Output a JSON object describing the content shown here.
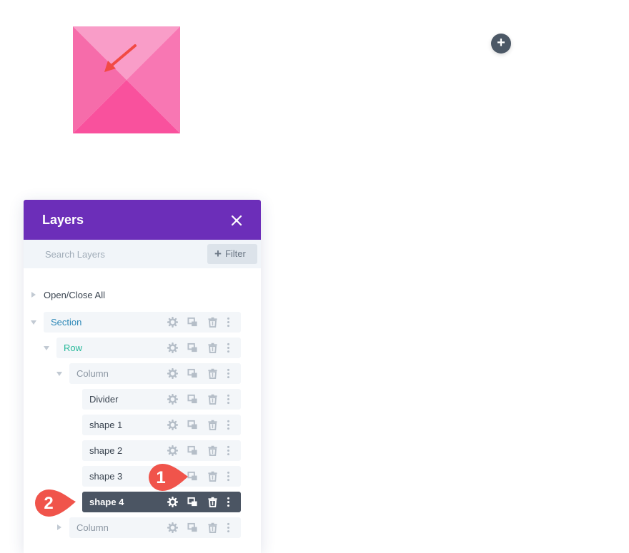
{
  "colors": {
    "header_bg": "#6c2eb9",
    "section_text": "#2d88b7",
    "row_text": "#27b99a",
    "column_text": "#8c97a3",
    "module_text": "#3a4450",
    "selected_bg": "#4b5563",
    "badge": "#f0544b",
    "shape_pink": "#f86aa9"
  },
  "add_button": {
    "icon": "plus-icon"
  },
  "layers_panel": {
    "title": "Layers",
    "close_icon": "close-icon",
    "search": {
      "placeholder": "Search Layers",
      "value": ""
    },
    "filter_label": "Filter",
    "toggle_all_label": "Open/Close All",
    "items": [
      {
        "label": "Section",
        "level": 0,
        "type": "section",
        "expanded": true
      },
      {
        "label": "Row",
        "level": 1,
        "type": "row",
        "expanded": true
      },
      {
        "label": "Column",
        "level": 2,
        "type": "column",
        "expanded": true
      },
      {
        "label": "Divider",
        "level": 3,
        "type": "module"
      },
      {
        "label": "shape 1",
        "level": 3,
        "type": "module"
      },
      {
        "label": "shape 2",
        "level": 3,
        "type": "module"
      },
      {
        "label": "shape 3",
        "level": 3,
        "type": "module"
      },
      {
        "label": "shape 4",
        "level": 3,
        "type": "module",
        "selected": true
      },
      {
        "label": "Column",
        "level": 2,
        "type": "column",
        "expanded": false
      }
    ],
    "row_action_icons": [
      "gear-icon",
      "duplicate-icon",
      "trash-icon",
      "more-icon"
    ]
  },
  "annotations": [
    {
      "number": "1"
    },
    {
      "number": "2"
    }
  ]
}
